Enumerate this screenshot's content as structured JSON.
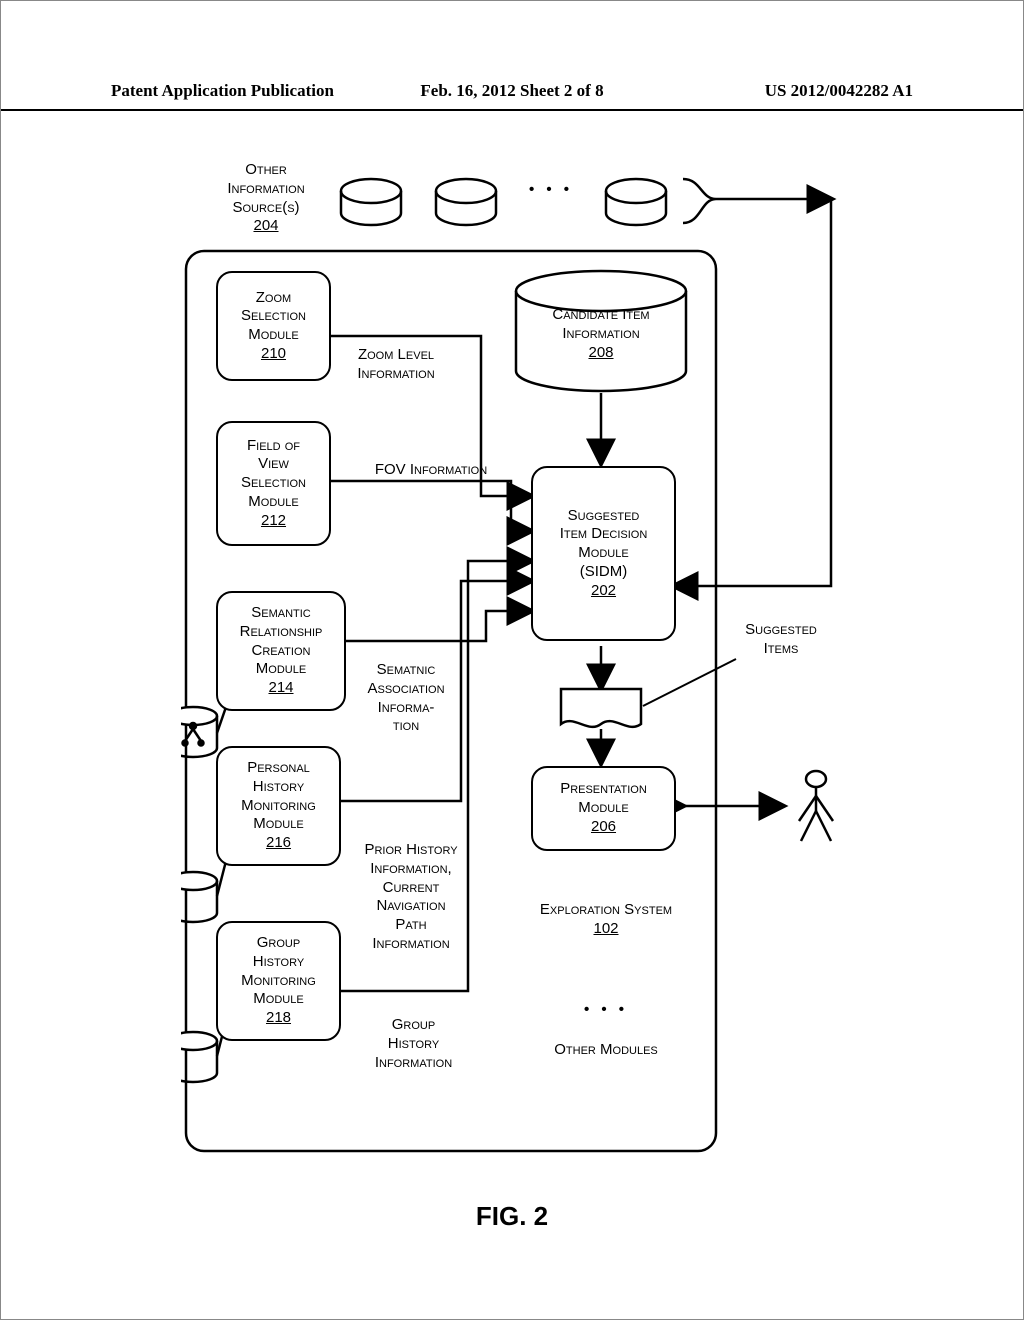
{
  "header": {
    "left": "Patent Application Publication",
    "center": "Feb. 16, 2012  Sheet 2 of 8",
    "right": "US 2012/0042282 A1"
  },
  "figure_caption": "FIG. 2",
  "top": {
    "other_info_sources_line1": "Other",
    "other_info_sources_line2": "Information",
    "other_info_sources_line3": "Source(s)",
    "other_info_sources_ref": "204",
    "ellipsis": "• • •"
  },
  "modules": {
    "zoom": {
      "l1": "Zoom",
      "l2": "Selection",
      "l3": "Module",
      "ref": "210"
    },
    "fov": {
      "l1": "Field of",
      "l2": "View",
      "l3": "Selection",
      "l4": "Module",
      "ref": "212"
    },
    "semantic": {
      "l1": "Semantic",
      "l2": "Relationship",
      "l3": "Creation",
      "l4": "Module",
      "ref": "214"
    },
    "personal": {
      "l1": "Personal",
      "l2": "History",
      "l3": "Monitoring",
      "l4": "Module",
      "ref": "216"
    },
    "group": {
      "l1": "Group",
      "l2": "History",
      "l3": "Monitoring",
      "l4": "Module",
      "ref": "218"
    },
    "candidate": {
      "l1": "Candidate Item",
      "l2": "Information",
      "ref": "208"
    },
    "sidm": {
      "l1": "Suggested",
      "l2": "Item Decision",
      "l3": "Module",
      "l4": "(SIDM)",
      "ref": "202"
    },
    "presentation": {
      "l1": "Presentation",
      "l2": "Module",
      "ref": "206"
    },
    "exploration": {
      "l1": "Exploration System",
      "ref": "102"
    },
    "other_modules_dots": "• • •",
    "other_modules": "Other Modules"
  },
  "flow_labels": {
    "zoom_level": "Zoom Level\nInformation",
    "fov_info": "FOV Information",
    "semantic_assoc": "Sematnic\nAssociation\nInforma-\ntion",
    "prior_history": "Prior History\nInformation,\nCurrent\nNavigation\nPath\nInformation",
    "group_history": "Group\nHistory\nInformation",
    "suggested_items": "Suggested\nItems"
  }
}
